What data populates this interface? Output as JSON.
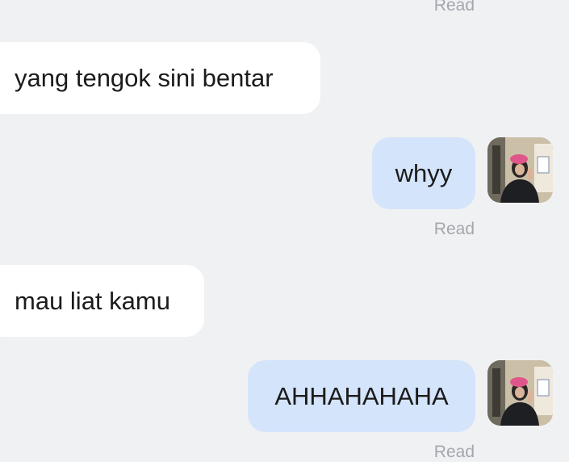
{
  "messages": [
    {
      "direction": "incoming",
      "text": "yang tengok sini bentar"
    },
    {
      "direction": "outgoing",
      "text": "whyy",
      "receipt": "Read",
      "avatar": "profile-photo"
    },
    {
      "direction": "incoming",
      "text": "mau liat kamu"
    },
    {
      "direction": "outgoing",
      "text": "AHHAHAHAHA",
      "receipt": "Read",
      "avatar": "profile-photo"
    }
  ],
  "top_receipt": "Read",
  "colors": {
    "background": "#f0f1f3",
    "incoming_bubble": "#ffffff",
    "outgoing_bubble": "#d4e4fb",
    "receipt_text": "#a3a7ad"
  }
}
